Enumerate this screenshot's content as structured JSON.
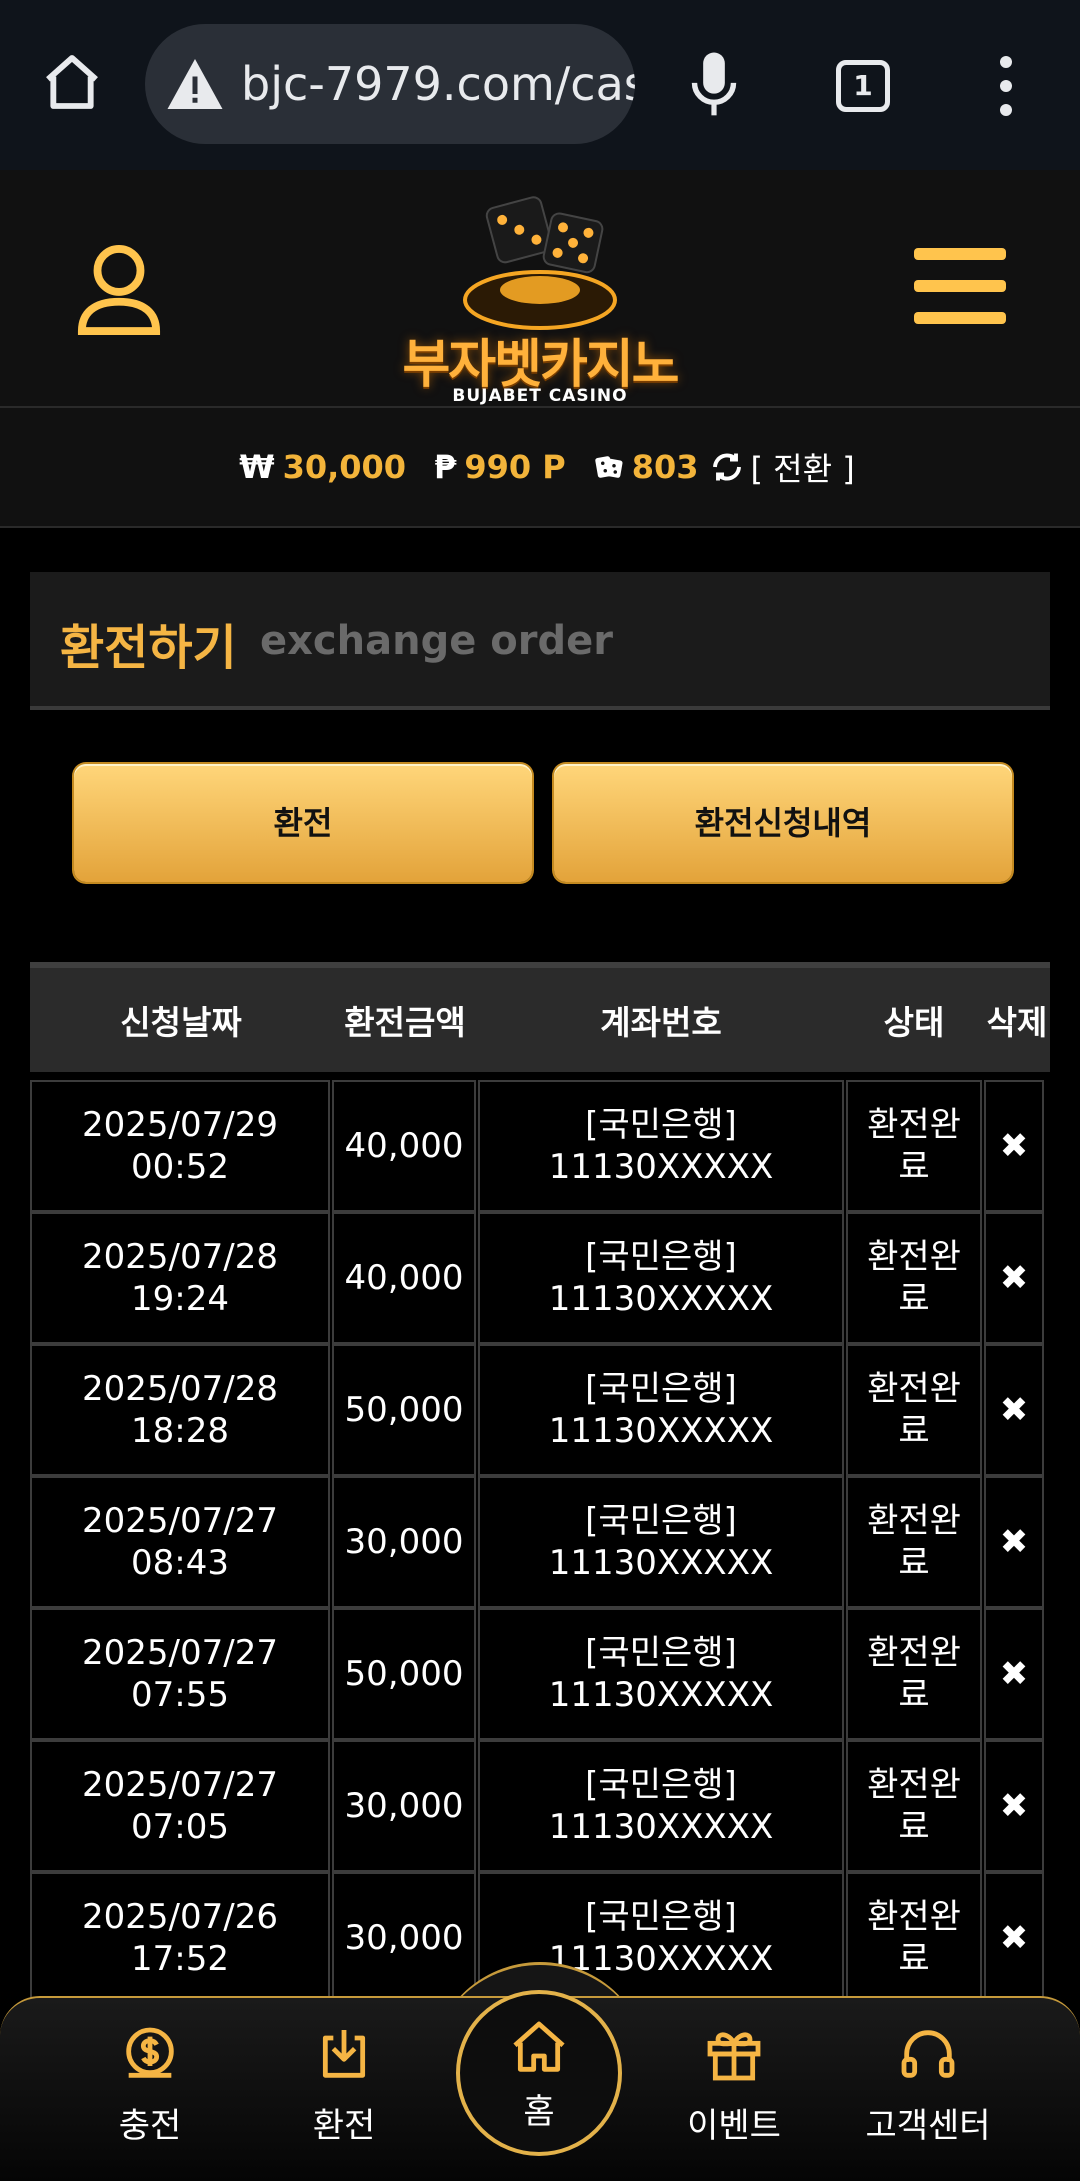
{
  "browser": {
    "url": "bjc-7979.com/cas",
    "tab_count": "1"
  },
  "site": {
    "logo_ko": "부자벳카지노",
    "logo_en": "BUJABET CASINO"
  },
  "balance": {
    "money_symbol": "₩",
    "money": "30,000",
    "point_symbol": "₱",
    "points": "990 P",
    "chip_value": "803",
    "convert_label": "[ 전환 ]"
  },
  "page": {
    "title_ko": "환전하기",
    "title_en": "exchange order"
  },
  "buttons": {
    "exchange": "환전",
    "history": "환전신청내역"
  },
  "table": {
    "headers": [
      "신청날짜",
      "환전금액",
      "계좌번호",
      "상태",
      "삭제"
    ],
    "rows": [
      {
        "date": "2025/07/29",
        "time": "00:52",
        "amount": "40,000",
        "bank": "[국민은행]",
        "account": "11130XXXXX",
        "status_1": "환전완",
        "status_2": "료",
        "delete": "✖"
      },
      {
        "date": "2025/07/28",
        "time": "19:24",
        "amount": "40,000",
        "bank": "[국민은행]",
        "account": "11130XXXXX",
        "status_1": "환전완",
        "status_2": "료",
        "delete": "✖"
      },
      {
        "date": "2025/07/28",
        "time": "18:28",
        "amount": "50,000",
        "bank": "[국민은행]",
        "account": "11130XXXXX",
        "status_1": "환전완",
        "status_2": "료",
        "delete": "✖"
      },
      {
        "date": "2025/07/27",
        "time": "08:43",
        "amount": "30,000",
        "bank": "[국민은행]",
        "account": "11130XXXXX",
        "status_1": "환전완",
        "status_2": "료",
        "delete": "✖"
      },
      {
        "date": "2025/07/27",
        "time": "07:55",
        "amount": "50,000",
        "bank": "[국민은행]",
        "account": "11130XXXXX",
        "status_1": "환전완",
        "status_2": "료",
        "delete": "✖"
      },
      {
        "date": "2025/07/27",
        "time": "07:05",
        "amount": "30,000",
        "bank": "[국민은행]",
        "account": "11130XXXXX",
        "status_1": "환전완",
        "status_2": "료",
        "delete": "✖"
      },
      {
        "date": "2025/07/26",
        "time": "17:52",
        "amount": "30,000",
        "bank": "[국민은행]",
        "account": "11130XXXXX",
        "status_1": "환전완",
        "status_2": "료",
        "delete": "✖"
      }
    ]
  },
  "nav": {
    "deposit": "충전",
    "withdraw": "환전",
    "home": "홈",
    "event": "이벤트",
    "support": "고객센터"
  },
  "colors": {
    "accent": "#f5b544",
    "background": "#000000"
  }
}
